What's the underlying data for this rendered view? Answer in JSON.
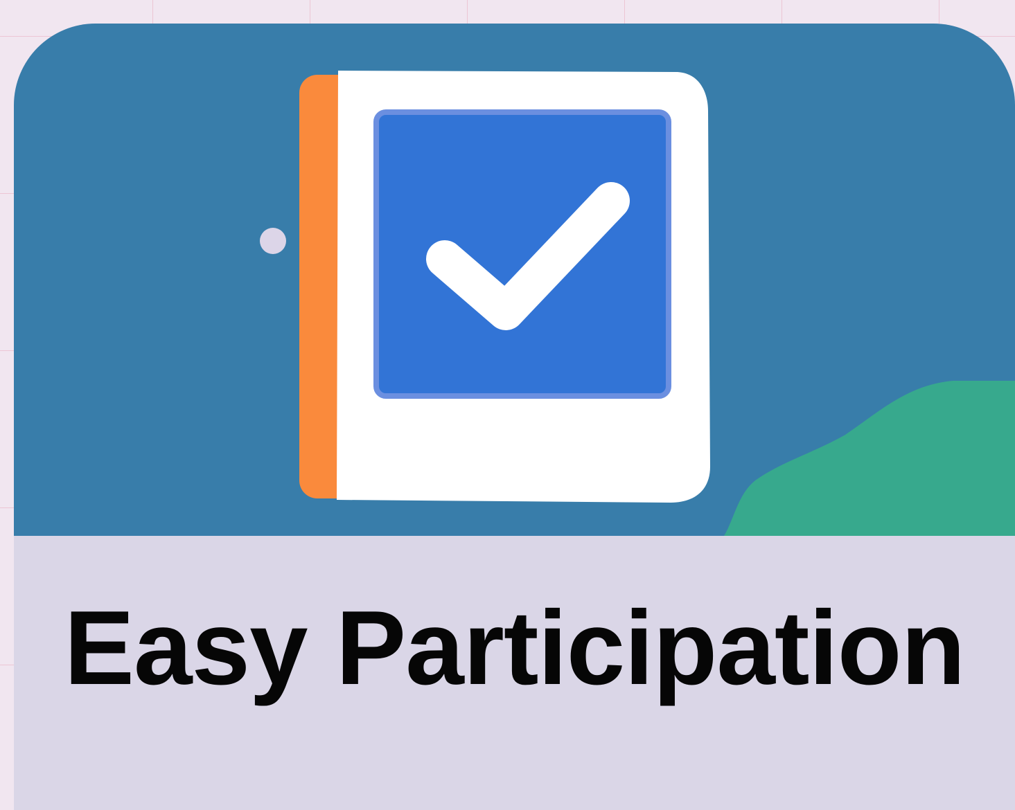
{
  "card": {
    "title": "Easy Participation",
    "illustration_icon": "checklist-book-icon"
  },
  "colors": {
    "page_background": "#f1e6f0",
    "illustration_background": "#387daa",
    "caption_background": "#dad6e7",
    "book_spine": "#fa8a3c",
    "book_cover": "#ffffff",
    "checkbox_fill": "#3274d6",
    "checkmark": "#ffffff",
    "hill": "#37a98d",
    "dot": "#dcd5e8",
    "title_text": "#060606"
  }
}
